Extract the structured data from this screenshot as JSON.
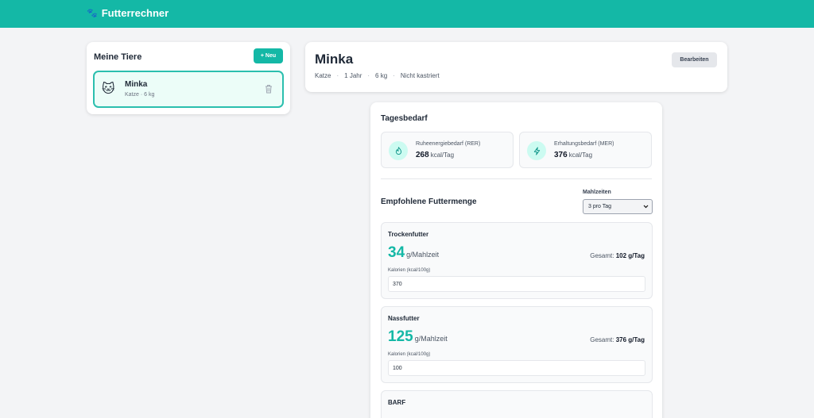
{
  "app": {
    "title": "Futterrechner"
  },
  "sidebar": {
    "title": "Meine Tiere",
    "new_button": "+ Neu",
    "pets": [
      {
        "emoji": "🐱",
        "name": "Minka",
        "subtitle": "Katze · 6 kg"
      }
    ]
  },
  "pet": {
    "name": "Minka",
    "species": "Katze",
    "age": "1 Jahr",
    "weight": "6 kg",
    "neutered": "Nicht kastriert",
    "edit_button": "Bearbeiten"
  },
  "daily": {
    "title": "Tagesbedarf",
    "rer": {
      "label": "Ruheenergiebedarf (RER)",
      "value": "268",
      "unit": "kcal/Tag"
    },
    "mer": {
      "label": "Erhaltungsbedarf (MER)",
      "value": "376",
      "unit": "kcal/Tag"
    }
  },
  "recommendation": {
    "title": "Empfohlene Futtermenge",
    "meals_label": "Mahlzeiten",
    "meals_selected": "3 pro Tag",
    "foods": [
      {
        "name": "Trockenfutter",
        "per_meal": "34",
        "unit": "g/Mahlzeit",
        "total_label": "Gesamt:",
        "total": "102 g/Tag",
        "kcal_label": "Kalorien (kcal/100g)",
        "kcal_value": "370"
      },
      {
        "name": "Nassfutter",
        "per_meal": "125",
        "unit": "g/Mahlzeit",
        "total_label": "Gesamt:",
        "total": "376 g/Tag",
        "kcal_label": "Kalorien (kcal/100g)",
        "kcal_value": "100"
      },
      {
        "name": "BARF"
      }
    ]
  },
  "colors": {
    "accent": "#14b8a6",
    "background": "#f3f4f6"
  }
}
